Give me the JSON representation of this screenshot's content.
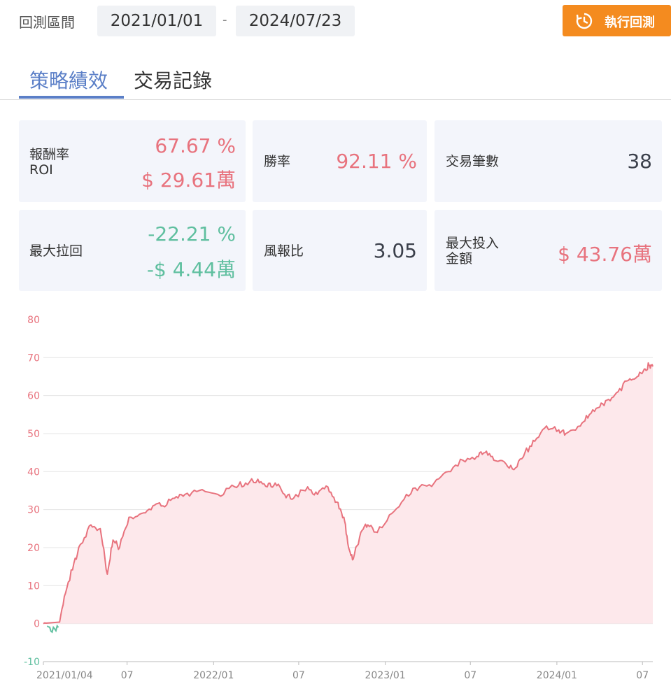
{
  "range": {
    "label": "回測區間",
    "start": "2021/01/01",
    "separator": "-",
    "end": "2024/07/23"
  },
  "run_button": {
    "label": "執行回測",
    "icon": "refresh-clock-icon",
    "color": "#f48b1f"
  },
  "tabs": [
    {
      "label": "策略績效",
      "active": true
    },
    {
      "label": "交易記錄",
      "active": false
    }
  ],
  "metrics": {
    "roi": {
      "label_line1": "報酬率",
      "label_line2": "ROI",
      "percent": "67.67 %",
      "amount": "$ 29.61萬"
    },
    "win_rate": {
      "label": "勝率",
      "value": "92.11 %"
    },
    "trade_count": {
      "label": "交易筆數",
      "value": "38"
    },
    "max_drawdown": {
      "label": "最大拉回",
      "percent": "-22.21 %",
      "amount": "-$ 4.44萬"
    },
    "risk_reward": {
      "label": "風報比",
      "value": "3.05"
    },
    "max_invest": {
      "label_line1": "最大投入",
      "label_line2": "金額",
      "value": "$ 43.76萬"
    }
  },
  "colors": {
    "positive": "#e8737e",
    "negative": "#5fbf9f",
    "accent": "#5b7fc7",
    "area_fill": "#fde8eb"
  },
  "chart_data": {
    "type": "area",
    "title": "",
    "xlabel": "",
    "ylabel": "",
    "ylim": [
      -10,
      80
    ],
    "y_ticks": [
      "80",
      "70",
      "60",
      "50",
      "40",
      "30",
      "20",
      "10",
      "0",
      "-10"
    ],
    "x_ticks": [
      "2021/01/04",
      "07",
      "2022/01",
      "07",
      "2023/01",
      "07",
      "2024/01",
      "07"
    ],
    "grid": true,
    "series": [
      {
        "x": [
          "2021/01/04",
          "2021/01/20",
          "2021/02/05",
          "2021/02/20",
          "2021/03/10",
          "2021/03/25",
          "2021/04/15",
          "2021/05/05",
          "2021/05/20",
          "2021/06/01",
          "2021/06/15",
          "2021/07/05",
          "2021/08/01",
          "2021/08/25",
          "2021/09/15",
          "2021/10/10",
          "2021/11/01",
          "2021/12/01",
          "2022/01/10",
          "2022/02/15",
          "2022/03/10",
          "2022/04/05",
          "2022/04/25",
          "2022/05/12",
          "2022/06/01",
          "2022/06/20",
          "2022/07/20",
          "2022/08/10",
          "2022/09/01",
          "2022/09/20",
          "2022/10/05",
          "2022/10/15",
          "2022/10/25",
          "2022/11/10",
          "2022/11/25",
          "2022/12/15",
          "2023/01/15",
          "2023/02/15",
          "2023/03/15",
          "2023/04/15",
          "2023/05/15",
          "2023/06/15",
          "2023/07/15",
          "2023/08/01",
          "2023/08/20",
          "2023/09/15",
          "2023/10/05",
          "2023/10/25",
          "2023/11/15",
          "2023/12/10",
          "2024/01/05",
          "2024/01/20",
          "2024/02/20",
          "2024/03/10",
          "2024/04/01",
          "2024/04/20",
          "2024/05/10",
          "2024/06/01",
          "2024/06/20",
          "2024/07/05",
          "2024/07/15",
          "2024/07/23"
        ],
        "values": [
          0,
          -2,
          -1,
          8,
          16,
          21,
          26,
          25,
          13,
          22,
          20,
          28,
          29,
          31,
          31,
          33,
          34,
          35,
          34,
          36,
          37,
          38,
          36,
          37,
          34,
          33,
          36,
          34,
          36,
          32,
          28,
          20,
          17,
          24,
          26,
          24,
          29,
          34,
          36,
          37,
          40,
          43,
          44,
          45,
          43,
          42,
          41,
          45,
          48,
          52,
          51,
          50,
          52,
          55,
          57,
          59,
          61,
          64,
          65,
          67,
          68,
          67.67
        ]
      }
    ]
  }
}
